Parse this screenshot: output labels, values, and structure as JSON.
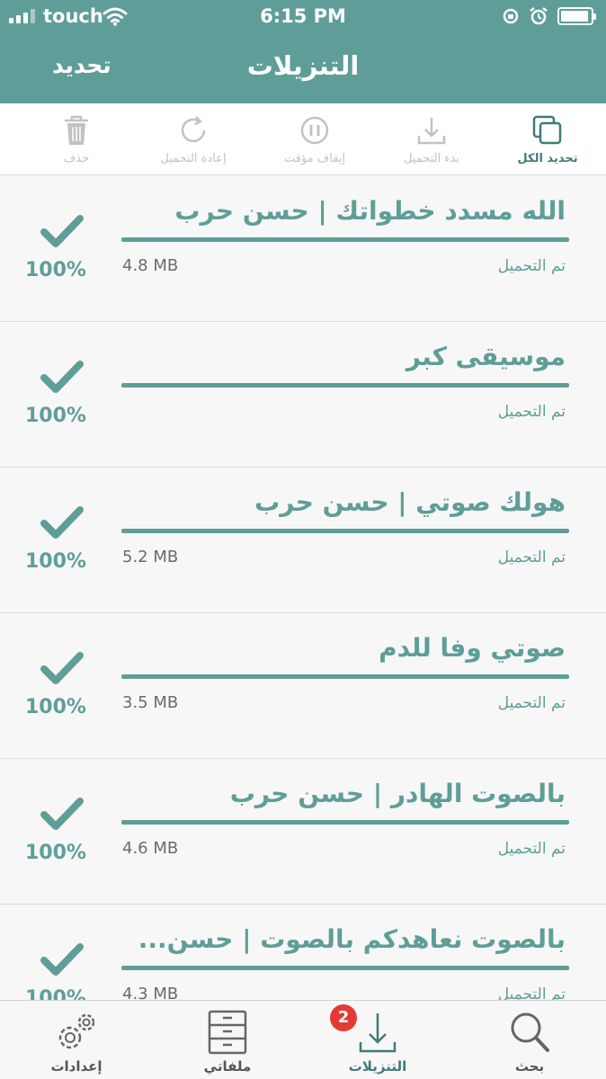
{
  "status_bar": {
    "carrier": "touch",
    "time": "6:15 PM"
  },
  "header": {
    "edit_label": "تحديد",
    "title": "التنزيلات"
  },
  "toolbar": {
    "select_all": "تحديد الكل",
    "start_download": "بدء التحميل",
    "pause": "إيقاف مؤقت",
    "retry": "إعادة التحميل",
    "delete": "حذف"
  },
  "downloads": [
    {
      "title": "الله مسدد خطواتك | حسن حرب",
      "status": "تم التحميل",
      "size": "4.8 MB",
      "progress": "100%"
    },
    {
      "title": "موسيقى كبر",
      "status": "تم التحميل",
      "size": "",
      "progress": "100%"
    },
    {
      "title": "هولك صوتي | حسن حرب",
      "status": "تم التحميل",
      "size": "5.2 MB",
      "progress": "100%"
    },
    {
      "title": "صوتي وفا للدم",
      "status": "تم التحميل",
      "size": "3.5 MB",
      "progress": "100%"
    },
    {
      "title": "بالصوت الهادر | حسن حرب",
      "status": "تم التحميل",
      "size": "4.6 MB",
      "progress": "100%"
    },
    {
      "title": "بالصوت نعاهدكم بالصوت | حسن...",
      "status": "تم التحميل",
      "size": "4.3 MB",
      "progress": "100%"
    }
  ],
  "tabs": {
    "settings": "إعدادات",
    "files": "ملفاتي",
    "downloads": "التنزيلات",
    "downloads_badge": "2",
    "search": "بحث"
  },
  "colors": {
    "accent": "#5f9e98",
    "accent_dark": "#3f7b76",
    "badge": "#e53935",
    "disabled": "#c2c2c2"
  },
  "icons": {
    "toolbar": [
      "select-all-icon",
      "download-icon",
      "pause-icon",
      "refresh-icon",
      "trash-icon"
    ],
    "tabs": [
      "gears-icon",
      "cabinet-icon",
      "download-icon",
      "search-icon"
    ]
  }
}
